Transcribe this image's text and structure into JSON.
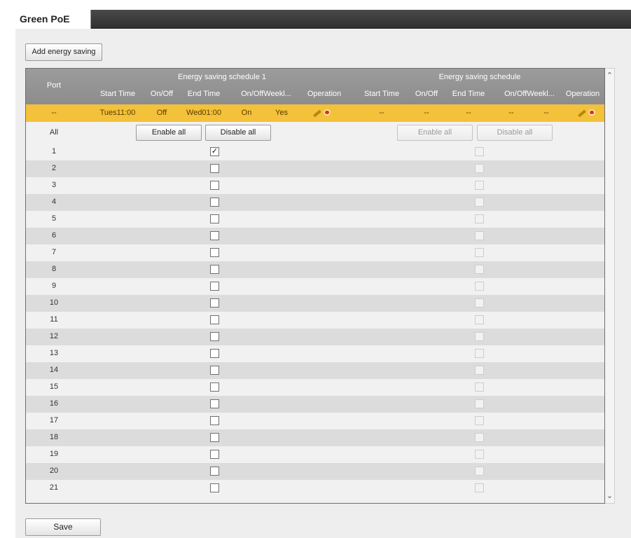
{
  "tab": {
    "title": "Green PoE"
  },
  "toolbar": {
    "add_label": "Add energy saving"
  },
  "table": {
    "port_header": "Port",
    "schedule1_title": "Energy saving schedule 1",
    "schedule2_title": "Energy saving schedule",
    "sub_headers": [
      "Start Time",
      "On/Off",
      "End Time",
      "On/OffWeekl...",
      "Operation"
    ],
    "schedule_row": {
      "port": "--",
      "s1": {
        "start": "Tues11:00",
        "start_state": "Off",
        "end": "Wed01:00",
        "end_state": "On",
        "weekly": "Yes"
      },
      "s2": {
        "start": "--",
        "start_state": "--",
        "end": "--",
        "end_state": "--",
        "weekly": "--"
      }
    },
    "all_row": {
      "label": "All",
      "enable_all_1": "Enable all",
      "disable_all_1": "Disable all",
      "enable_all_2": "Enable all",
      "disable_all_2": "Disable all"
    },
    "ports": [
      {
        "port": "1",
        "checked": true
      },
      {
        "port": "2",
        "checked": false
      },
      {
        "port": "3",
        "checked": false
      },
      {
        "port": "4",
        "checked": false
      },
      {
        "port": "5",
        "checked": false
      },
      {
        "port": "6",
        "checked": false
      },
      {
        "port": "7",
        "checked": false
      },
      {
        "port": "8",
        "checked": false
      },
      {
        "port": "9",
        "checked": false
      },
      {
        "port": "10",
        "checked": false
      },
      {
        "port": "11",
        "checked": false
      },
      {
        "port": "12",
        "checked": false
      },
      {
        "port": "13",
        "checked": false
      },
      {
        "port": "14",
        "checked": false
      },
      {
        "port": "15",
        "checked": false
      },
      {
        "port": "16",
        "checked": false
      },
      {
        "port": "17",
        "checked": false
      },
      {
        "port": "18",
        "checked": false
      },
      {
        "port": "19",
        "checked": false
      },
      {
        "port": "20",
        "checked": false
      },
      {
        "port": "21",
        "checked": false
      }
    ],
    "check_mark": "✓"
  },
  "footer": {
    "save_label": "Save"
  },
  "icons": {
    "edit": "pencil-icon",
    "delete": "delete-icon",
    "scroll_up": "chevron-up-icon",
    "scroll_down": "chevron-down-icon"
  },
  "colors": {
    "header_bg": "#8c8c8c",
    "selected_row": "#f3c13a",
    "tab_bar": "#3a3a3a"
  }
}
